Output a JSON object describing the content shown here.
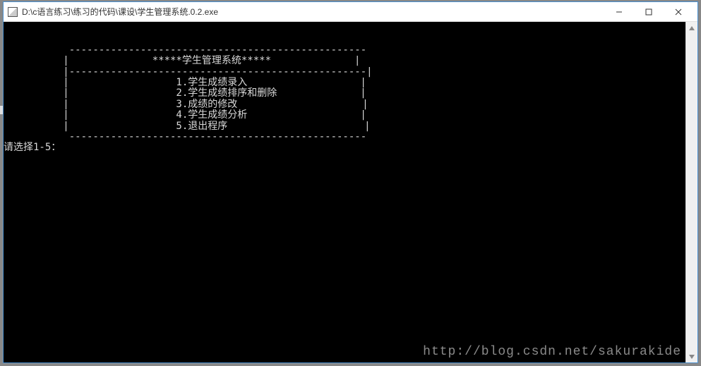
{
  "window": {
    "title": "D:\\c语言练习\\练习的代码\\课设\\学生管理系统.0.2.exe"
  },
  "controls": {
    "minimize": "—",
    "maximize": "□",
    "close": "×"
  },
  "menu": {
    "border_top": "           --------------------------------------------------",
    "header": "          |              *****学生管理系统*****              |",
    "border_mid": "          |--------------------------------------------------|",
    "items": [
      "          |                  1.学生成绩录入                   |",
      "          |                  2.学生成绩排序和删除              |",
      "          |                  3.成绩的修改                     |",
      "          |                  4.学生成绩分析                   |",
      "          |                  5.退出程序                       |"
    ],
    "border_bot": "           --------------------------------------------------"
  },
  "prompt": "请选择1-5：",
  "watermark": "http://blog.csdn.net/sakurakide"
}
